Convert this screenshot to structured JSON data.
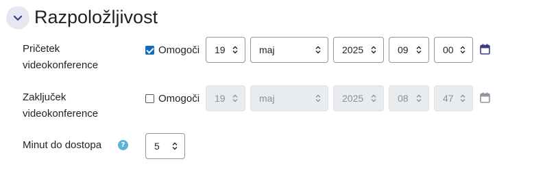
{
  "section": {
    "title": "Razpoložljivost"
  },
  "start": {
    "label_line1": "Pričetek",
    "label_line2": "videokonference",
    "enable_label": "Omogoči",
    "enabled": true,
    "day": "19",
    "month": "maj",
    "year": "2025",
    "hour": "09",
    "minute": "00"
  },
  "end": {
    "label_line1": "Zaključek",
    "label_line2": "videokonference",
    "enable_label": "Omogoči",
    "enabled": false,
    "day": "19",
    "month": "maj",
    "year": "2025",
    "hour": "08",
    "minute": "47"
  },
  "minutes": {
    "label": "Minut do dostopa",
    "help_symbol": "?",
    "value": "5"
  },
  "colors": {
    "accent": "#0f6cbf",
    "help": "#5ab4d6",
    "calendar_active": "#3d3a8c",
    "calendar_disabled": "#8f959e"
  }
}
